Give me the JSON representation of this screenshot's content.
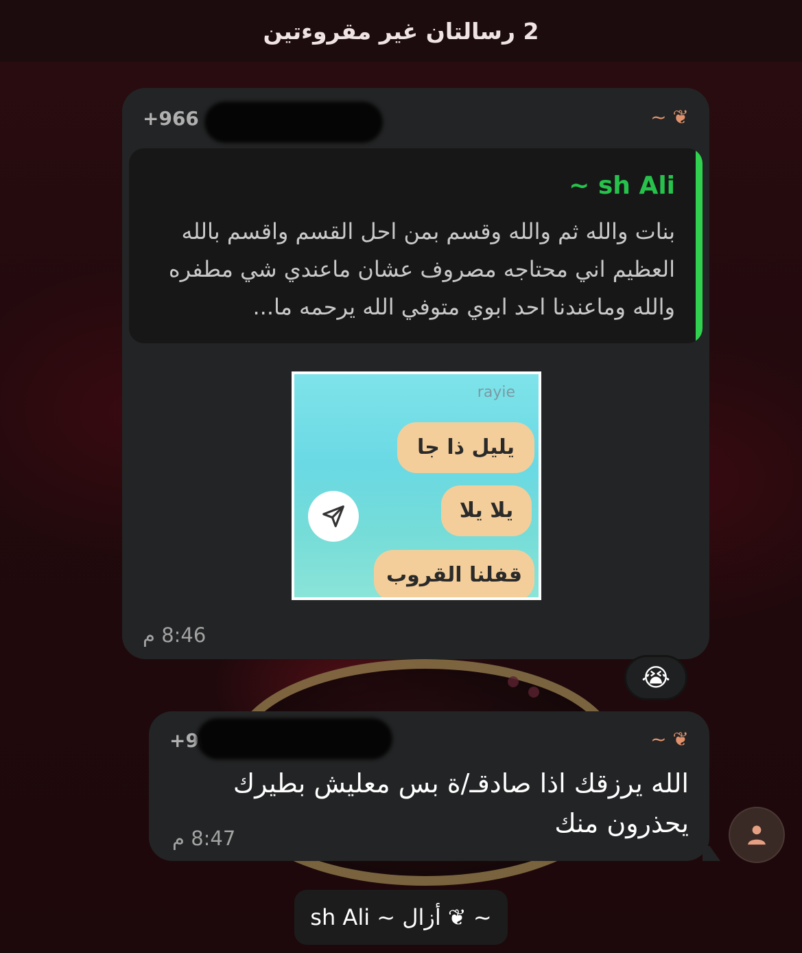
{
  "header": {
    "title": "2 رسالتان غير مقروءتين"
  },
  "message_1": {
    "sender_phone": "+966",
    "sender_name": "~ ❦",
    "quote": {
      "name": "~ sh Ali",
      "text": "بنات والله ثم والله وقسم بمن احل القسم واقسم بالله العظيم اني محتاجه مصروف عشان ماعندي شي مطفره والله وماعندنا احد ابوي متوفي الله يرحمه ما..."
    },
    "sticker": {
      "label": "rayie",
      "pills": [
        "يليل ذا جا",
        "يلا يلا",
        "قفلنا القروب"
      ],
      "send_icon": "send-icon"
    },
    "time": "8:46 م",
    "reaction": "😭"
  },
  "message_2": {
    "sender_phone": "+96",
    "sender_name": "~ ❦",
    "text": "الله يرزقك اذا صادقـ/ة بس معليش بطيرك يحذرون منك",
    "time": "8:47 م"
  },
  "avatar": {
    "icon": "person-icon"
  },
  "system_message": {
    "text": "~ ❦ أزال ~ sh Ali"
  },
  "colors": {
    "bubble": "#232425",
    "quote_accent": "#2fd14f",
    "quote_name": "#27c24c",
    "sender_name": "#e0926c",
    "sticker_pill": "#f4ce9a"
  }
}
